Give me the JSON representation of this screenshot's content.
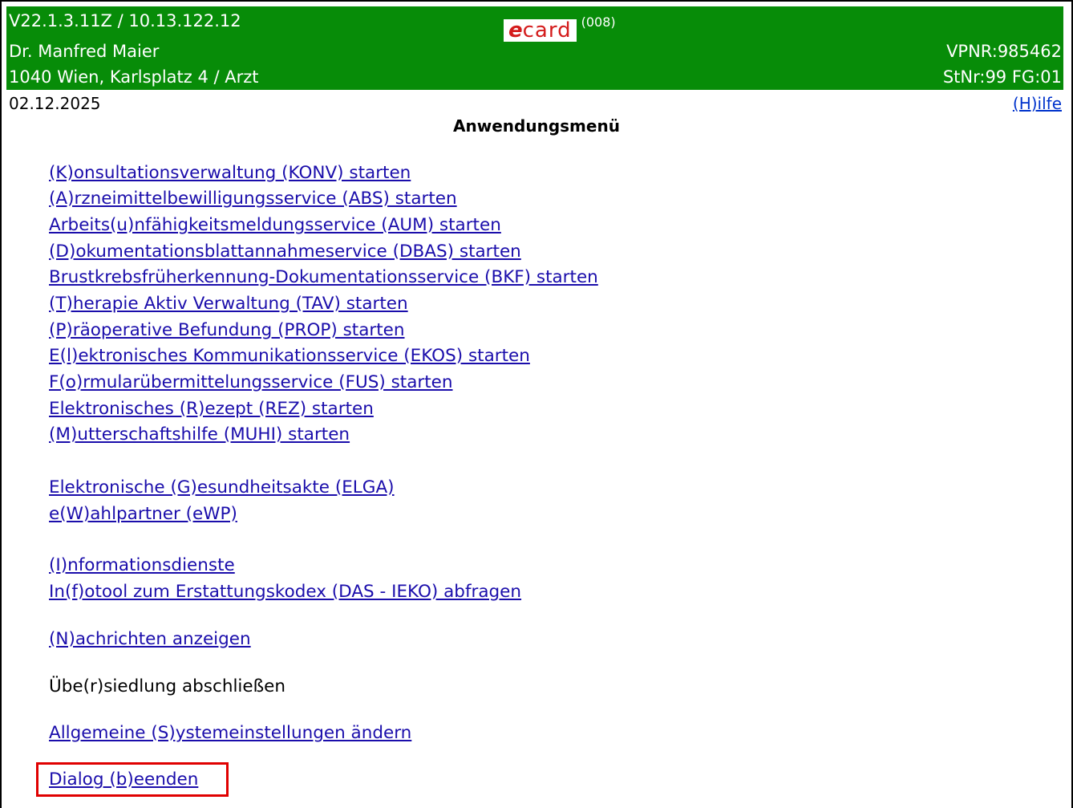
{
  "header": {
    "version": "V22.1.3.11Z / 10.13.122.12",
    "logo_e": "e",
    "logo_card": "card",
    "logo_code": "(008)",
    "doctor": "Dr. Manfred Maier",
    "vpnr": "VPNR:985462",
    "address": "1040 Wien, Karlsplatz 4 / Arzt",
    "stnr": "StNr:99 FG:01",
    "header_bg": "#078c08"
  },
  "date": "02.12.2025",
  "help_link": "(H)ilfe",
  "page_title": "Anwendungsmenü",
  "menu": {
    "konv": "(K)onsultationsverwaltung (KONV) starten",
    "abs": "(A)rzneimittelbewilligungsservice (ABS) starten",
    "aum": "Arbeits(u)nfähigkeitsmeldungsservice (AUM) starten",
    "dbas": "(D)okumentationsblattannahmeservice (DBAS) starten",
    "bkf": "Brustkrebsfrüherkennung-Dokumentationsservice (BKF) starten",
    "tav": "(T)herapie Aktiv Verwaltung (TAV) starten",
    "prop": "(P)räoperative Befundung (PROP) starten",
    "ekos": "E(l)ektronisches Kommunikationsservice (EKOS) starten",
    "fus": "F(o)rmularübermittelungsservice (FUS) starten",
    "rez": "Elektronisches (R)ezept (REZ) starten",
    "muhi": "(M)utterschaftshilfe (MUHI) starten",
    "elga": "Elektronische (G)esundheitsakte (ELGA)",
    "ewp": "e(W)ahlpartner (eWP)",
    "info": "(I)nformationsdienste",
    "ieko": "In(f)otool zum Erstattungskodex (DAS - IEKO) abfragen",
    "news": "(N)achrichten anzeigen",
    "relocate": "Übe(r)siedlung abschließen",
    "settings": "Allgemeine (S)ystemeinstellungen ändern",
    "quit": "Dialog (b)eenden"
  },
  "highlight_color": "#e00000"
}
